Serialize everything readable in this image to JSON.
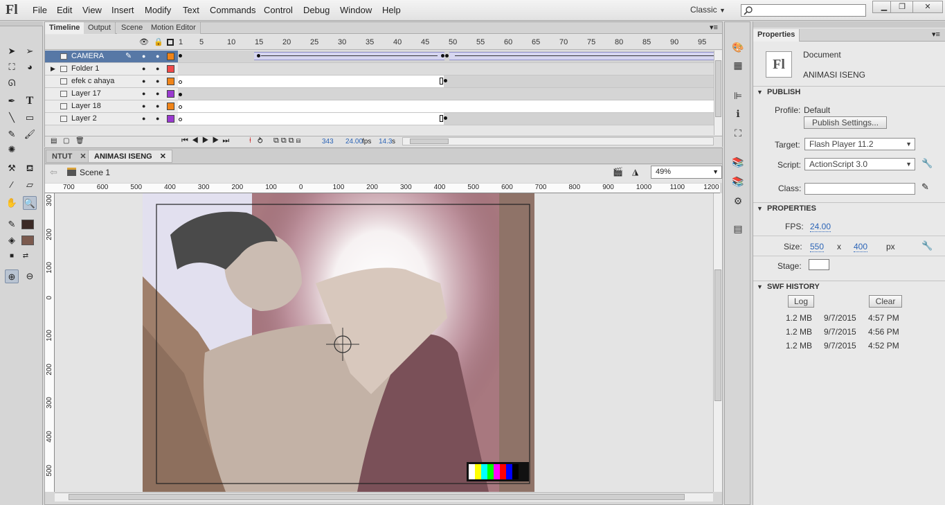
{
  "app": {
    "logo": "Fl"
  },
  "menu": [
    "File",
    "Edit",
    "View",
    "Insert",
    "Modify",
    "Text",
    "Commands",
    "Control",
    "Debug",
    "Window",
    "Help"
  ],
  "workspace": "Classic",
  "timeline": {
    "tabs": [
      "Timeline",
      "Output",
      "Scene",
      "Motion Editor"
    ],
    "ruler": [
      "1",
      "5",
      "10",
      "15",
      "20",
      "25",
      "30",
      "35",
      "40",
      "45",
      "50",
      "55",
      "60",
      "65",
      "70",
      "75",
      "80",
      "85",
      "90",
      "95"
    ],
    "layers": [
      {
        "name": "CAMERA",
        "color": "#f08418"
      },
      {
        "name": "Folder 1",
        "color": "#f04a4a"
      },
      {
        "name": "efek c ahaya",
        "color": "#f08418"
      },
      {
        "name": "Layer 17",
        "color": "#9a3ad0"
      },
      {
        "name": "Layer 18",
        "color": "#f08418"
      },
      {
        "name": "Layer 2",
        "color": "#9a3ad0"
      }
    ],
    "status": {
      "frame": "343",
      "fps": "24.00",
      "fps_unit": "fps",
      "time": "14.3",
      "time_unit": "s"
    }
  },
  "documents": {
    "tabs": [
      "NTUT",
      "ANIMASI ISENG"
    ],
    "scene": "Scene 1",
    "zoom": "49%"
  },
  "hruler": [
    "700",
    "600",
    "500",
    "400",
    "300",
    "200",
    "100",
    "0",
    "100",
    "200",
    "300",
    "400",
    "500",
    "600",
    "700",
    "800",
    "900",
    "1000",
    "1100",
    "1200"
  ],
  "vruler": [
    "300",
    "200",
    "100",
    "0",
    "100",
    "200",
    "300",
    "400",
    "500"
  ],
  "properties": {
    "tab": "Properties",
    "doc_type": "Document",
    "doc_name": "ANIMASI ISENG",
    "publish_head": "PUBLISH",
    "profile_label": "Profile:",
    "profile_value": "Default",
    "publish_settings": "Publish Settings...",
    "target_label": "Target:",
    "target_value": "Flash Player 11.2",
    "script_label": "Script:",
    "script_value": "ActionScript 3.0",
    "class_label": "Class:",
    "properties_head": "PROPERTIES",
    "fps_label": "FPS:",
    "fps_value": "24.00",
    "size_label": "Size:",
    "width": "550",
    "times": "x",
    "height": "400",
    "unit": "px",
    "stage_label": "Stage:",
    "stage_color": "#ffffff",
    "swf_head": "SWF HISTORY",
    "log_btn": "Log",
    "clear_btn": "Clear",
    "history": [
      {
        "size": "1.2 MB",
        "date": "9/7/2015",
        "time": "4:57 PM"
      },
      {
        "size": "1.2 MB",
        "date": "9/7/2015",
        "time": "4:56 PM"
      },
      {
        "size": "1.2 MB",
        "date": "9/7/2015",
        "time": "4:52 PM"
      }
    ]
  },
  "colors": {
    "stroke": "#3b2a26",
    "fill": "#7b5a4e",
    "accent": "#5778a6"
  }
}
